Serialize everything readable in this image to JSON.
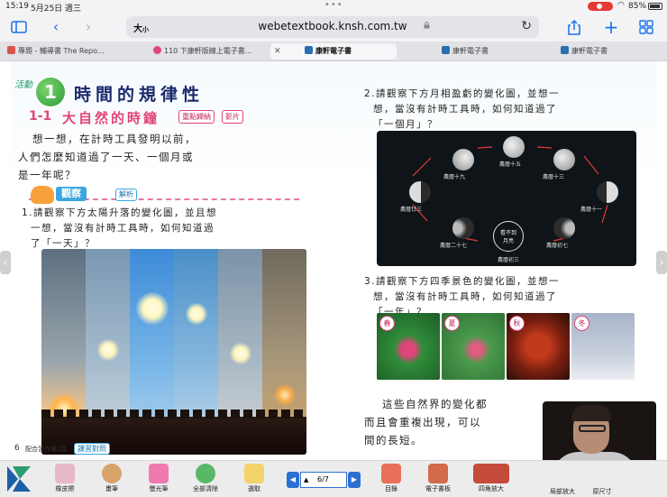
{
  "status_bar": {
    "time": "15:19",
    "date": "5月25日 週三",
    "battery": "85%",
    "wifi_icon": "wifi-icon"
  },
  "toolbar": {
    "text_size": "大",
    "text_size_small": "小",
    "url": "webetextbook.knsh.com.tw"
  },
  "tabs": [
    {
      "label": "專題 - 輔導書 The Repo...",
      "color": "#d9534f"
    },
    {
      "label": "110 下康軒版線上電子書...",
      "color": "#e0457a"
    },
    {
      "label": "康軒電子書",
      "color": "#2a6fb0"
    },
    {
      "label": "康軒電子書",
      "color": "#2a6fb0"
    },
    {
      "label": "康軒電子書",
      "color": "#2a6fb0"
    }
  ],
  "left_page": {
    "activity_label": "活動",
    "activity_number": "1",
    "chapter_title": "時間的規律性",
    "section_number": "1-1",
    "section_title": "大自然的時鐘",
    "tag_summary": "重點歸納",
    "tag_video": "影片",
    "intro_line1": "想一想，在計時工具發明以前，",
    "intro_line2": "人們怎麼知道過了一天、一個月或",
    "intro_line3": "是一年呢？",
    "observe_label": "觀察",
    "analysis_label": "解析",
    "q1_line1": "1.請觀察下方太陽升落的變化圖，並且想",
    "q1_line2": "一想，當沒有計時工具時，如何知道過",
    "q1_line3": "了「一天」？",
    "page_number": "6",
    "page_note": "配合習作第2頁",
    "class_reference": "課習對照"
  },
  "right_page": {
    "q2_line1": "2.請觀察下方月相盈虧的變化圖，並想一",
    "q2_line2": "想，當沒有計時工具時，如何知道過了",
    "q2_line3": "「一個月」？",
    "moon_labels": [
      "農曆十五",
      "農曆十三",
      "農曆十九",
      "農曆十一",
      "農曆廿三",
      "農曆初七",
      "農曆二十七",
      "農曆初三"
    ],
    "moon_center": [
      "看不到",
      "月亮"
    ],
    "q3_line1": "3.請觀察下方四季景色的變化圖，並想一",
    "q3_line2": "想，當沒有計時工具時，如何知道過了",
    "q3_line3": "「一年」？",
    "seasons": [
      "春",
      "夏",
      "秋",
      "冬"
    ],
    "closing_line1": "這些自然界的變化都",
    "closing_line2": "而且會重複出現，可以",
    "closing_line3": "間的長短。"
  },
  "bottom_bar": {
    "tools": [
      "橡皮擦",
      "畫筆",
      "螢光筆",
      "全部清除",
      "選取"
    ],
    "page_indicator": "6/7",
    "right_tools": [
      "目錄",
      "電子書板",
      "四角放大",
      "局部放大",
      "原尺寸"
    ]
  }
}
